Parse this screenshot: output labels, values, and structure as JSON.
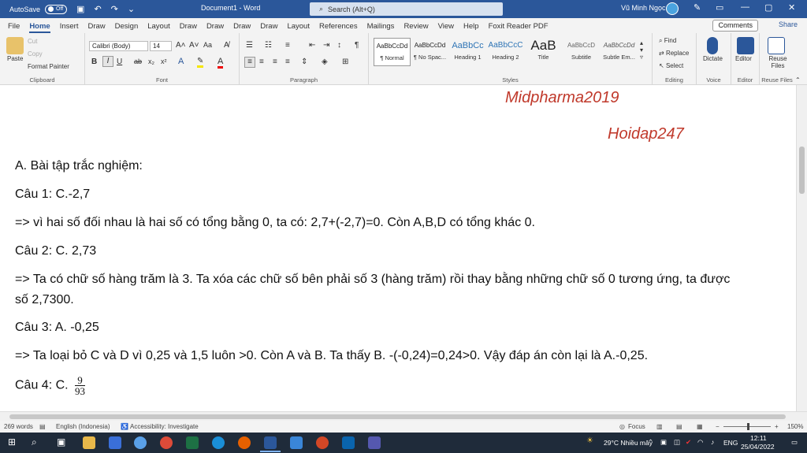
{
  "titlebar": {
    "autosave_label": "AutoSave",
    "autosave_state": "Off",
    "doc_title": "Document1  -  Word",
    "search_placeholder": "Search (Alt+Q)",
    "user_name": "Vũ Minh Ngọc"
  },
  "tabs": [
    "File",
    "Home",
    "Insert",
    "Draw",
    "Design",
    "Layout",
    "Draw",
    "Draw",
    "Draw",
    "Draw",
    "Layout",
    "References",
    "Mailings",
    "Review",
    "View",
    "Help",
    "Foxit Reader PDF"
  ],
  "active_tab": "Home",
  "comments_label": "Comments",
  "share_label": "Share",
  "ribbon": {
    "clipboard": {
      "paste": "Paste",
      "cut": "Cut",
      "copy": "Copy",
      "format_painter": "Format Painter",
      "label": "Clipboard"
    },
    "font": {
      "family": "Calibri (Body)",
      "size": "14",
      "label": "Font"
    },
    "paragraph": {
      "label": "Paragraph"
    },
    "styles": {
      "label": "Styles",
      "items": [
        {
          "sample": "AaBbCcDd",
          "name": "¶ Normal"
        },
        {
          "sample": "AaBbCcDd",
          "name": "¶ No Spac..."
        },
        {
          "sample": "AaBbCc",
          "name": "Heading 1"
        },
        {
          "sample": "AaBbCcC",
          "name": "Heading 2"
        },
        {
          "sample": "AaB",
          "name": "Title"
        },
        {
          "sample": "AaBbCcD",
          "name": "Subtitle"
        },
        {
          "sample": "AaBbCcDd",
          "name": "Subtle Em..."
        }
      ]
    },
    "editing": {
      "find": "Find",
      "replace": "Replace",
      "select": "Select",
      "label": "Editing"
    },
    "voice": {
      "dictate": "Dictate",
      "label": "Voice"
    },
    "editor": {
      "editor": "Editor",
      "label": "Editor"
    },
    "reuse": {
      "reuse": "Reuse Files",
      "label": "Reuse Files"
    }
  },
  "document": {
    "header1": "Midpharma2019",
    "header2": "Hoidap247",
    "lines": [
      "A. Bài tập trắc nghiệm:",
      "Câu 1: C.-2,7",
      "=> vì hai số đối nhau là hai số có tổng bằng 0, ta có: 2,7+(-2,7)=0. Còn A,B,D có tổng khác 0.",
      "Câu 2: C. 2,73",
      "=> Ta có chữ số hàng trăm là 3. Ta xóa các chữ số bên phải số 3 (hàng trăm) rồi thay bằng những chữ số 0 tương ứng, ta được",
      "số 2,7300.",
      "Câu 3: A. -0,25",
      "=> Ta loại bỏ C và D vì 0,25 và 1,5 luôn >0. Còn A và B. Ta thấy B. -(-0,24)=0,24>0. Vậy đáp án còn lại là A.-0,25.",
      "Câu 4: C."
    ],
    "fraction": {
      "num": "9",
      "den": "93"
    }
  },
  "statusbar": {
    "words": "269 words",
    "language": "English (Indonesia)",
    "accessibility": "Accessibility: Investigate",
    "focus": "Focus",
    "zoom": "150%"
  },
  "taskbar": {
    "weather": "29°C  Nhiều mây",
    "lang": "ENG",
    "time": "12:11",
    "date": "25/04/2022"
  },
  "colors": {
    "word_blue": "#2b579a",
    "header_red": "#c0392b"
  }
}
